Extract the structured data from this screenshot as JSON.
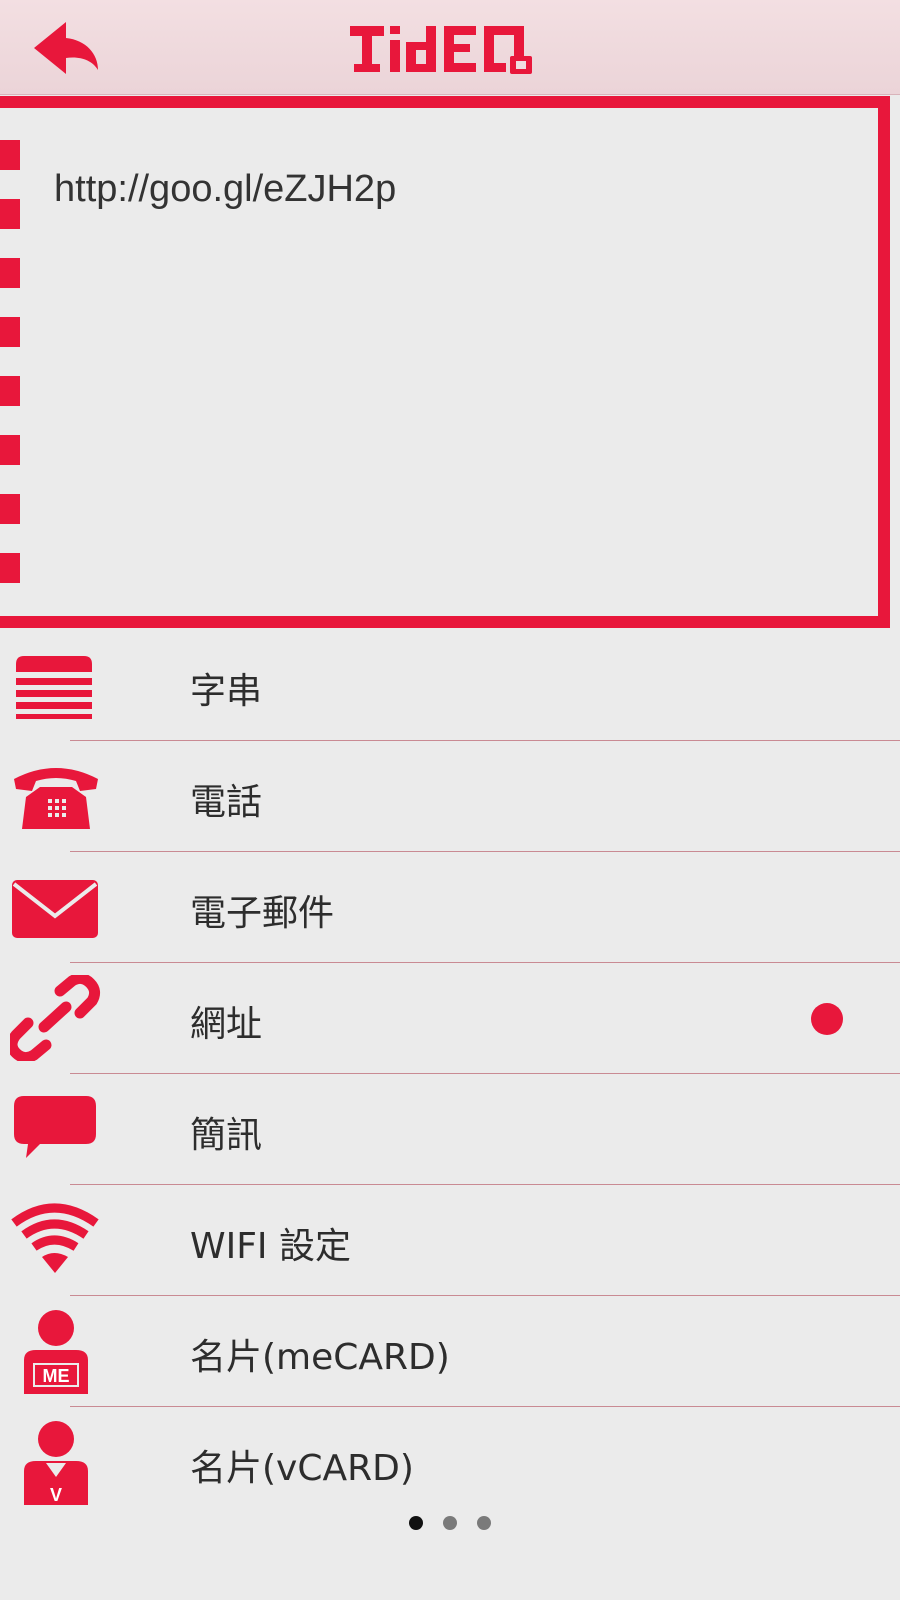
{
  "header": {
    "logo_text": "TidEQ",
    "back_icon": "back-arrow-icon"
  },
  "colors": {
    "accent": "#e8173b",
    "header_bg": "#f0dde0",
    "background": "#ebebeb"
  },
  "text_panel": {
    "value": "http://goo.gl/eZJH2p"
  },
  "list": {
    "items": [
      {
        "label": "字串",
        "icon": "text-lines-icon",
        "selected": false
      },
      {
        "label": "電話",
        "icon": "telephone-icon",
        "selected": false
      },
      {
        "label": "電子郵件",
        "icon": "envelope-icon",
        "selected": false
      },
      {
        "label": "網址",
        "icon": "link-icon",
        "selected": true
      },
      {
        "label": "簡訊",
        "icon": "speech-bubble-icon",
        "selected": false
      },
      {
        "label": "WIFI 設定",
        "icon": "wifi-icon",
        "selected": false
      },
      {
        "label": "名片(meCARD)",
        "icon": "person-me-icon",
        "badge": "ME",
        "selected": false
      },
      {
        "label": "名片(vCARD)",
        "icon": "person-v-icon",
        "badge": "V",
        "selected": false
      }
    ]
  },
  "pager": {
    "total": 3,
    "current": 1
  }
}
